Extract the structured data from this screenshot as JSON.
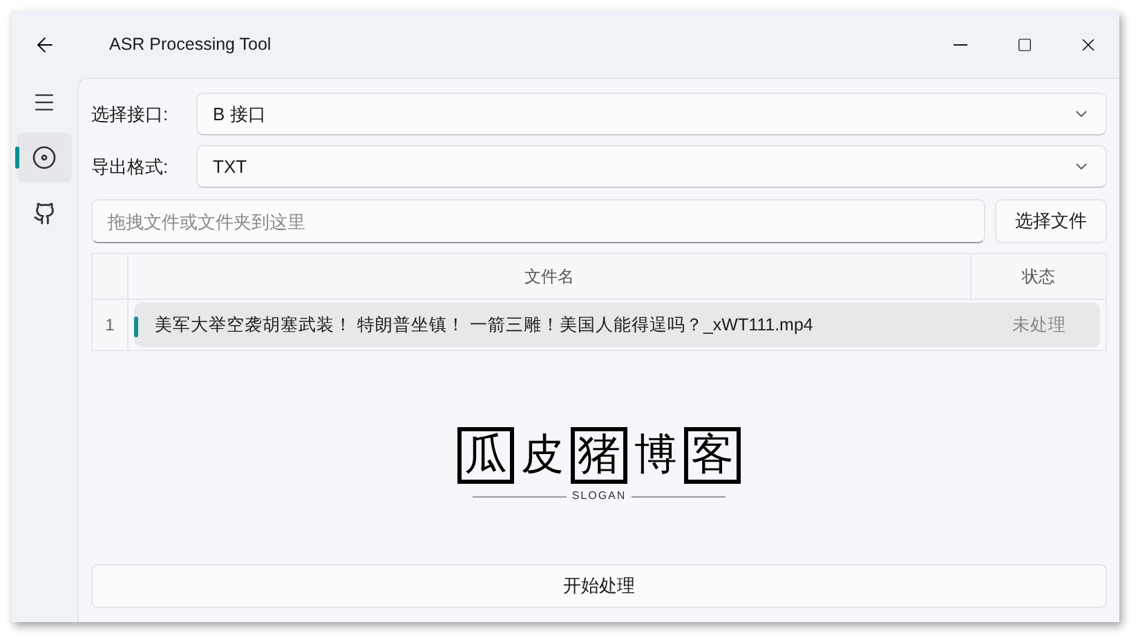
{
  "window": {
    "title": "ASR Processing Tool"
  },
  "sidebar": {
    "items": [
      {
        "kind": "menu",
        "selected": false
      },
      {
        "kind": "disc",
        "selected": true
      },
      {
        "kind": "github",
        "selected": false
      }
    ]
  },
  "form": {
    "interface": {
      "label": "选择接口:",
      "value": "B 接口"
    },
    "format": {
      "label": "导出格式:",
      "value": "TXT"
    },
    "drop": {
      "placeholder": "拖拽文件或文件夹到这里"
    },
    "choose_button": "选择文件"
  },
  "table": {
    "columns": [
      "文件名",
      "状态"
    ],
    "rows": [
      {
        "index": "1",
        "name": "美军大举空袭胡塞武装！ 特朗普坐镇！ 一箭三雕！美国人能得逞吗？_xWT111.mp4",
        "status": "未处理",
        "selected": true
      }
    ]
  },
  "logo": {
    "characters": [
      {
        "text": "瓜",
        "boxed": true
      },
      {
        "text": "皮",
        "boxed": false
      },
      {
        "text": "猪",
        "boxed": true
      },
      {
        "text": "博",
        "boxed": false
      },
      {
        "text": "客",
        "boxed": true
      }
    ],
    "slogan": "SLOGAN"
  },
  "start_button": "开始处理"
}
